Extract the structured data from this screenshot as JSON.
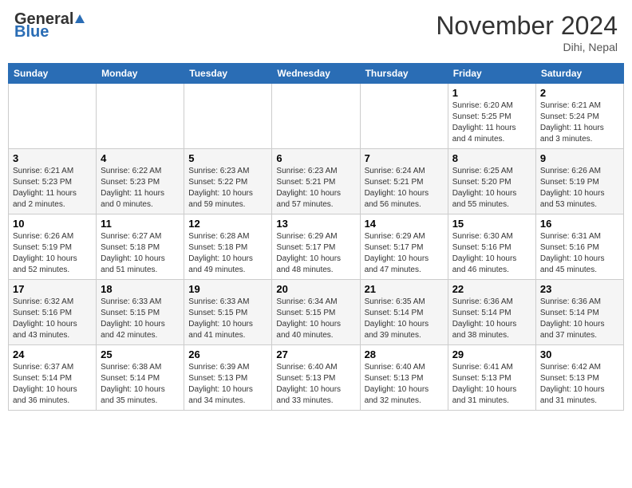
{
  "header": {
    "logo_general": "General",
    "logo_blue": "Blue",
    "month_title": "November 2024",
    "location": "Dihi, Nepal"
  },
  "days_of_week": [
    "Sunday",
    "Monday",
    "Tuesday",
    "Wednesday",
    "Thursday",
    "Friday",
    "Saturday"
  ],
  "weeks": [
    [
      {
        "day": "",
        "info": ""
      },
      {
        "day": "",
        "info": ""
      },
      {
        "day": "",
        "info": ""
      },
      {
        "day": "",
        "info": ""
      },
      {
        "day": "",
        "info": ""
      },
      {
        "day": "1",
        "info": "Sunrise: 6:20 AM\nSunset: 5:25 PM\nDaylight: 11 hours and 4 minutes."
      },
      {
        "day": "2",
        "info": "Sunrise: 6:21 AM\nSunset: 5:24 PM\nDaylight: 11 hours and 3 minutes."
      }
    ],
    [
      {
        "day": "3",
        "info": "Sunrise: 6:21 AM\nSunset: 5:23 PM\nDaylight: 11 hours and 2 minutes."
      },
      {
        "day": "4",
        "info": "Sunrise: 6:22 AM\nSunset: 5:23 PM\nDaylight: 11 hours and 0 minutes."
      },
      {
        "day": "5",
        "info": "Sunrise: 6:23 AM\nSunset: 5:22 PM\nDaylight: 10 hours and 59 minutes."
      },
      {
        "day": "6",
        "info": "Sunrise: 6:23 AM\nSunset: 5:21 PM\nDaylight: 10 hours and 57 minutes."
      },
      {
        "day": "7",
        "info": "Sunrise: 6:24 AM\nSunset: 5:21 PM\nDaylight: 10 hours and 56 minutes."
      },
      {
        "day": "8",
        "info": "Sunrise: 6:25 AM\nSunset: 5:20 PM\nDaylight: 10 hours and 55 minutes."
      },
      {
        "day": "9",
        "info": "Sunrise: 6:26 AM\nSunset: 5:19 PM\nDaylight: 10 hours and 53 minutes."
      }
    ],
    [
      {
        "day": "10",
        "info": "Sunrise: 6:26 AM\nSunset: 5:19 PM\nDaylight: 10 hours and 52 minutes."
      },
      {
        "day": "11",
        "info": "Sunrise: 6:27 AM\nSunset: 5:18 PM\nDaylight: 10 hours and 51 minutes."
      },
      {
        "day": "12",
        "info": "Sunrise: 6:28 AM\nSunset: 5:18 PM\nDaylight: 10 hours and 49 minutes."
      },
      {
        "day": "13",
        "info": "Sunrise: 6:29 AM\nSunset: 5:17 PM\nDaylight: 10 hours and 48 minutes."
      },
      {
        "day": "14",
        "info": "Sunrise: 6:29 AM\nSunset: 5:17 PM\nDaylight: 10 hours and 47 minutes."
      },
      {
        "day": "15",
        "info": "Sunrise: 6:30 AM\nSunset: 5:16 PM\nDaylight: 10 hours and 46 minutes."
      },
      {
        "day": "16",
        "info": "Sunrise: 6:31 AM\nSunset: 5:16 PM\nDaylight: 10 hours and 45 minutes."
      }
    ],
    [
      {
        "day": "17",
        "info": "Sunrise: 6:32 AM\nSunset: 5:16 PM\nDaylight: 10 hours and 43 minutes."
      },
      {
        "day": "18",
        "info": "Sunrise: 6:33 AM\nSunset: 5:15 PM\nDaylight: 10 hours and 42 minutes."
      },
      {
        "day": "19",
        "info": "Sunrise: 6:33 AM\nSunset: 5:15 PM\nDaylight: 10 hours and 41 minutes."
      },
      {
        "day": "20",
        "info": "Sunrise: 6:34 AM\nSunset: 5:15 PM\nDaylight: 10 hours and 40 minutes."
      },
      {
        "day": "21",
        "info": "Sunrise: 6:35 AM\nSunset: 5:14 PM\nDaylight: 10 hours and 39 minutes."
      },
      {
        "day": "22",
        "info": "Sunrise: 6:36 AM\nSunset: 5:14 PM\nDaylight: 10 hours and 38 minutes."
      },
      {
        "day": "23",
        "info": "Sunrise: 6:36 AM\nSunset: 5:14 PM\nDaylight: 10 hours and 37 minutes."
      }
    ],
    [
      {
        "day": "24",
        "info": "Sunrise: 6:37 AM\nSunset: 5:14 PM\nDaylight: 10 hours and 36 minutes."
      },
      {
        "day": "25",
        "info": "Sunrise: 6:38 AM\nSunset: 5:14 PM\nDaylight: 10 hours and 35 minutes."
      },
      {
        "day": "26",
        "info": "Sunrise: 6:39 AM\nSunset: 5:13 PM\nDaylight: 10 hours and 34 minutes."
      },
      {
        "day": "27",
        "info": "Sunrise: 6:40 AM\nSunset: 5:13 PM\nDaylight: 10 hours and 33 minutes."
      },
      {
        "day": "28",
        "info": "Sunrise: 6:40 AM\nSunset: 5:13 PM\nDaylight: 10 hours and 32 minutes."
      },
      {
        "day": "29",
        "info": "Sunrise: 6:41 AM\nSunset: 5:13 PM\nDaylight: 10 hours and 31 minutes."
      },
      {
        "day": "30",
        "info": "Sunrise: 6:42 AM\nSunset: 5:13 PM\nDaylight: 10 hours and 31 minutes."
      }
    ]
  ]
}
